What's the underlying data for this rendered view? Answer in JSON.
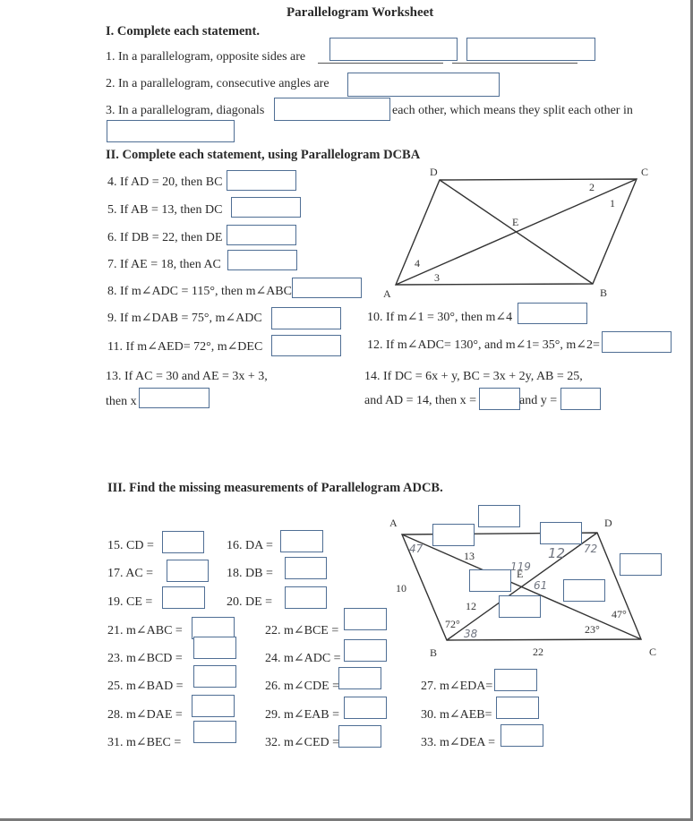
{
  "title": "Parallelogram Worksheet",
  "section1": {
    "heading": "I. Complete each statement.",
    "q1": "1. In a parallelogram, opposite sides are",
    "q2": "2. In a parallelogram, consecutive angles are",
    "q3_a": "3. In a parallelogram, diagonals",
    "q3_b": "each other, which means they split each other in"
  },
  "section2": {
    "heading": "II. Complete each statement, using Parallelogram DCBA",
    "q4": "4. If AD = 20, then BC",
    "q5": "5. If AB = 13, then DC",
    "q6": "6. If DB = 22, then DE",
    "q7": "7. If AE = 18, then AC",
    "q8": "8. If m∠ADC = 115°, then m∠ABC",
    "q9": "9. If m∠DAB = 75°,  m∠ADC",
    "q10": "10. If m∠1 = 30°, then m∠4",
    "q11": "11.  If m∠AED= 72°,  m∠DEC",
    "q12": "12. If m∠ADC= 130°,  and m∠1= 35°,  m∠2=",
    "q13_a": "13. If AC = 30 and AE = 3x + 3,",
    "q13_b": "then x",
    "q14_a": "14. If DC = 6x + y, BC = 3x + 2y, AB = 25,",
    "q14_b": "and AD = 14, then x =",
    "q14_c": "and y =",
    "diagram": {
      "vertices": {
        "A": "A",
        "B": "B",
        "C": "C",
        "D": "D",
        "E": "E"
      },
      "angle_labels": {
        "a1": "1",
        "a2": "2",
        "a3": "3",
        "a4": "4"
      }
    }
  },
  "section3": {
    "heading": "III. Find the missing measurements of Parallelogram ADCB.",
    "q15": "15. CD =",
    "q16": "16. DA =",
    "q17": "17. AC =",
    "q18": "18. DB =",
    "q19": "19. CE =",
    "q20": "20. DE =",
    "q21": "21. m∠ABC =",
    "q22": "22. m∠BCE =",
    "q23": "23. m∠BCD =",
    "q24": "24. m∠ADC =",
    "q25": "25. m∠BAD =",
    "q26": "26. m∠CDE =",
    "q27": "27. m∠EDA=",
    "q28": "28. m∠DAE =",
    "q29": "29. m∠EAB =",
    "q30": "30. m∠AEB=",
    "q31": "31. m∠BEC =",
    "q32": "32. m∠CED =",
    "q33": "33. m∠DEA =",
    "diagram": {
      "vertices": {
        "A": "A",
        "B": "B",
        "C": "C",
        "D": "D",
        "E": "E"
      },
      "given": {
        "AE": "13",
        "AB": "10",
        "BE": "12",
        "BC": "22",
        "ang_ABE": "72°",
        "ang_ECB": "23°",
        "ang_DCE": "47°"
      },
      "handwritten": {
        "ang_BAE": "47",
        "ang_EBC": "38",
        "ang_AED": "119",
        "ang_DEC": "61",
        "ED": "12",
        "ang_ADE": "72"
      }
    }
  }
}
